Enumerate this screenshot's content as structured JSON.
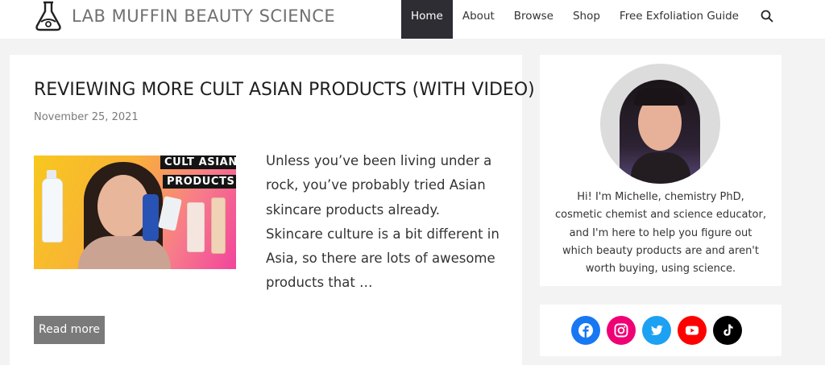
{
  "header": {
    "site_title": "LAB MUFFIN BEAUTY SCIENCE",
    "logo_icon": "flask-icon",
    "nav": [
      {
        "label": "Home",
        "active": true
      },
      {
        "label": "About",
        "active": false
      },
      {
        "label": "Browse",
        "active": false
      },
      {
        "label": "Shop",
        "active": false
      },
      {
        "label": "Free Exfoliation Guide",
        "active": false
      }
    ],
    "search_icon": "search-icon"
  },
  "post": {
    "title": "REVIEWING MORE CULT ASIAN PRODUCTS (WITH VIDEO)",
    "date": "November 25, 2021",
    "thumbnail": {
      "line1": "CULT ASIAN",
      "line2": "PRODUCTS"
    },
    "excerpt": "Unless you’ve been living under a rock, you’ve probably tried Asian skincare products already. Skincare culture is a bit different in Asia, so there are lots of awesome products that …",
    "read_more": "Read more"
  },
  "sidebar": {
    "bio": "Hi! I'm Michelle, chemistry PhD, cosmetic chemist and science educator, and I'm here to help you figure out which beauty products are and aren't worth buying, using science.",
    "social": [
      {
        "name": "facebook-icon",
        "color": "#1877f2"
      },
      {
        "name": "instagram-icon",
        "color": "#f00075"
      },
      {
        "name": "twitter-icon",
        "color": "#1da1f2"
      },
      {
        "name": "youtube-icon",
        "color": "#ff0000"
      },
      {
        "name": "tiktok-icon",
        "color": "#000000"
      }
    ]
  },
  "colors": {
    "nav_active_bg": "#2d2d33",
    "read_more_bg": "#7a7a7a",
    "page_bg": "#f3f3f3"
  }
}
